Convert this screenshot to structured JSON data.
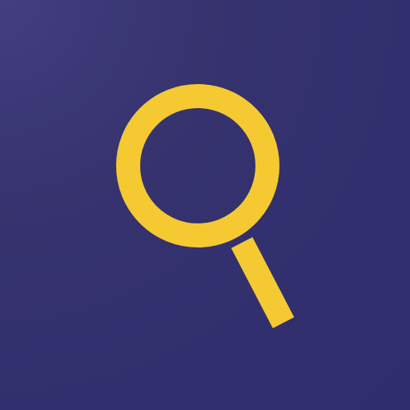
{
  "icon": {
    "name": "search-icon",
    "background_color": "#312f6d",
    "accent_color": "#f5c932"
  }
}
